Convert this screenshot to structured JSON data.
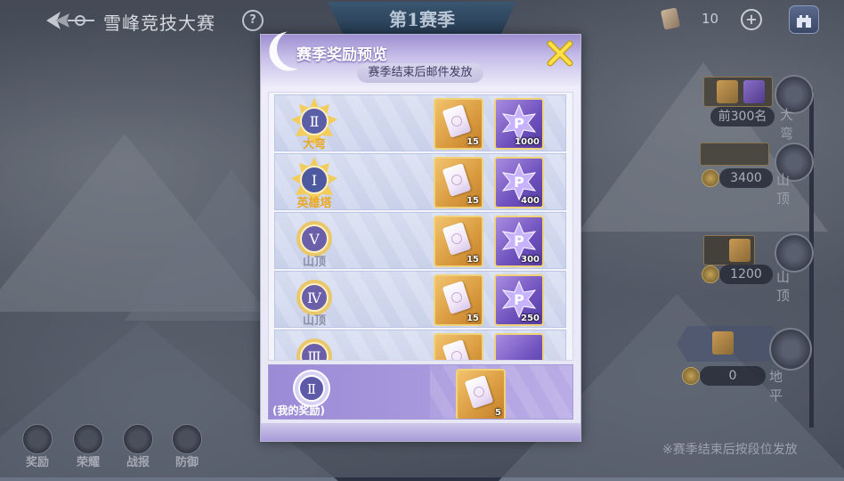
{
  "topbar": {
    "title": "雪峰竞技大赛",
    "help_glyph": "?",
    "season": "第1赛季",
    "ticket_count": "10",
    "add_glyph": "+"
  },
  "modal": {
    "title": "赛季奖励预览",
    "subtitle": "赛季结束后邮件发放",
    "rows": [
      {
        "name": "大弯",
        "name_color": "#e8a82a",
        "rewards": [
          {
            "kind": "ticket",
            "qty": "15"
          },
          {
            "kind": "points",
            "qty": "1000"
          }
        ]
      },
      {
        "name": "英雄塔",
        "name_color": "#e8a82a",
        "rewards": [
          {
            "kind": "ticket",
            "qty": "15"
          },
          {
            "kind": "points",
            "qty": "400"
          }
        ]
      },
      {
        "name": "山顶",
        "name_color": "#8a8fa8",
        "rewards": [
          {
            "kind": "ticket",
            "qty": "15"
          },
          {
            "kind": "points",
            "qty": "300"
          }
        ]
      },
      {
        "name": "山顶",
        "name_color": "#8a8fa8",
        "rewards": [
          {
            "kind": "ticket",
            "qty": "15"
          },
          {
            "kind": "points",
            "qty": "250"
          }
        ]
      },
      {
        "name": "",
        "name_color": "#8a8fa8",
        "rewards": [
          {
            "kind": "ticket",
            "qty": ""
          },
          {
            "kind": "points",
            "qty": ""
          }
        ]
      }
    ],
    "my_reward": {
      "label": "(我的奖励)",
      "qty": "5"
    }
  },
  "ladder": {
    "items": [
      {
        "threshold": "前300名",
        "name": "大弯"
      },
      {
        "threshold": "3400",
        "name": "山顶"
      },
      {
        "threshold": "1200",
        "name": "山顶"
      },
      {
        "threshold": "0",
        "name": "地平"
      }
    ],
    "footnote": "※赛季结束后按段位发放"
  },
  "bottom_nav": [
    {
      "label": "奖励",
      "icon": "gift-icon"
    },
    {
      "label": "荣耀",
      "icon": "crown-icon"
    },
    {
      "label": "战报",
      "icon": "scroll-icon"
    },
    {
      "label": "防御",
      "icon": "shield-icon"
    }
  ],
  "colors": {
    "accent_purple": "#9b8ad6",
    "gold": "#f0d27a",
    "close_yellow": "#ffe14a"
  }
}
